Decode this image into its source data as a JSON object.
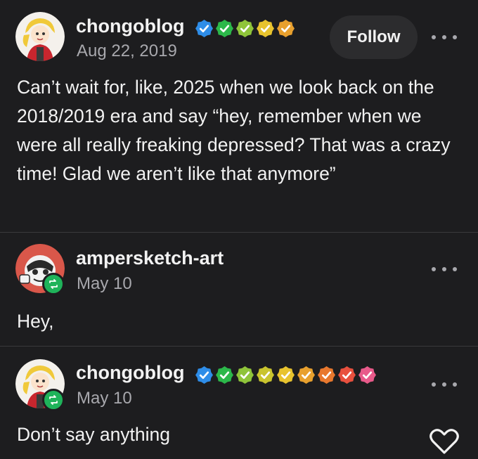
{
  "posts": [
    {
      "username": "chongoblog",
      "date": "Aug 22, 2019",
      "follow_label": "Follow",
      "text": "Can’t wait for, like, 2025 when we look back on the 2018/2019 era and say “hey, remember when we were all really freaking depressed? That was a crazy time! Glad we aren’t like that anymore”",
      "badge_colors": [
        "#2e8de8",
        "#2cb84a",
        "#8fc43a",
        "#e8c32e",
        "#e8a02e"
      ]
    },
    {
      "username": "ampersketch-art",
      "date": "May 10",
      "text": "Hey,",
      "reblogged": true
    },
    {
      "username": "chongoblog",
      "date": "May 10",
      "text": "Don’t say anything",
      "reblogged": true,
      "badge_colors": [
        "#2e8de8",
        "#2cb84a",
        "#8fc43a",
        "#c9c42e",
        "#e8c32e",
        "#e8a02e",
        "#e8782e",
        "#e8503e",
        "#e85a8a"
      ]
    }
  ],
  "icons": {
    "more": "more-horizontal-icon",
    "reblog": "reblog-icon",
    "like": "heart-icon",
    "verified": "checkmark-badge-icon"
  }
}
